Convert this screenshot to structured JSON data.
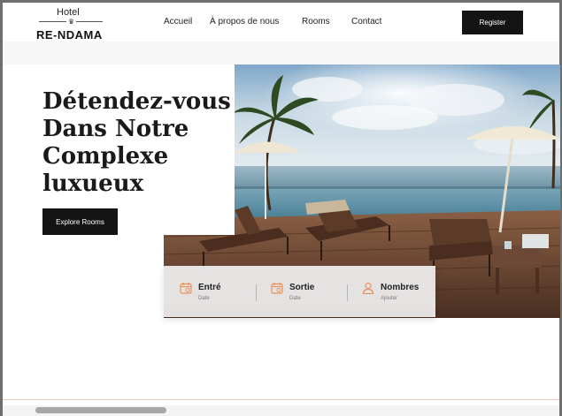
{
  "brand": {
    "top": "Hotel",
    "name": "RE-NDAMA",
    "crown": "♛"
  },
  "nav": {
    "items": [
      {
        "label": "Accueil"
      },
      {
        "label": "À propos de nous"
      },
      {
        "label": "Rooms"
      },
      {
        "label": "Contact"
      }
    ],
    "register": "Register"
  },
  "hero": {
    "title_lines": [
      "Détendez-vous",
      "Dans Notre",
      "Complexe",
      "luxueux"
    ],
    "cta": "Explore Rooms",
    "image": "beach resort with sun loungers, parasols and infinity pool by the sea"
  },
  "booking": {
    "items": [
      {
        "label": "Entré",
        "sub": "Date",
        "icon": "calendar-icon"
      },
      {
        "label": "Sortie",
        "sub": "Date",
        "icon": "calendar-icon"
      },
      {
        "label": "Nombres",
        "sub": "Ajouter",
        "icon": "user-icon"
      }
    ]
  },
  "colors": {
    "accent": "#e8925a",
    "dark": "#141414"
  }
}
